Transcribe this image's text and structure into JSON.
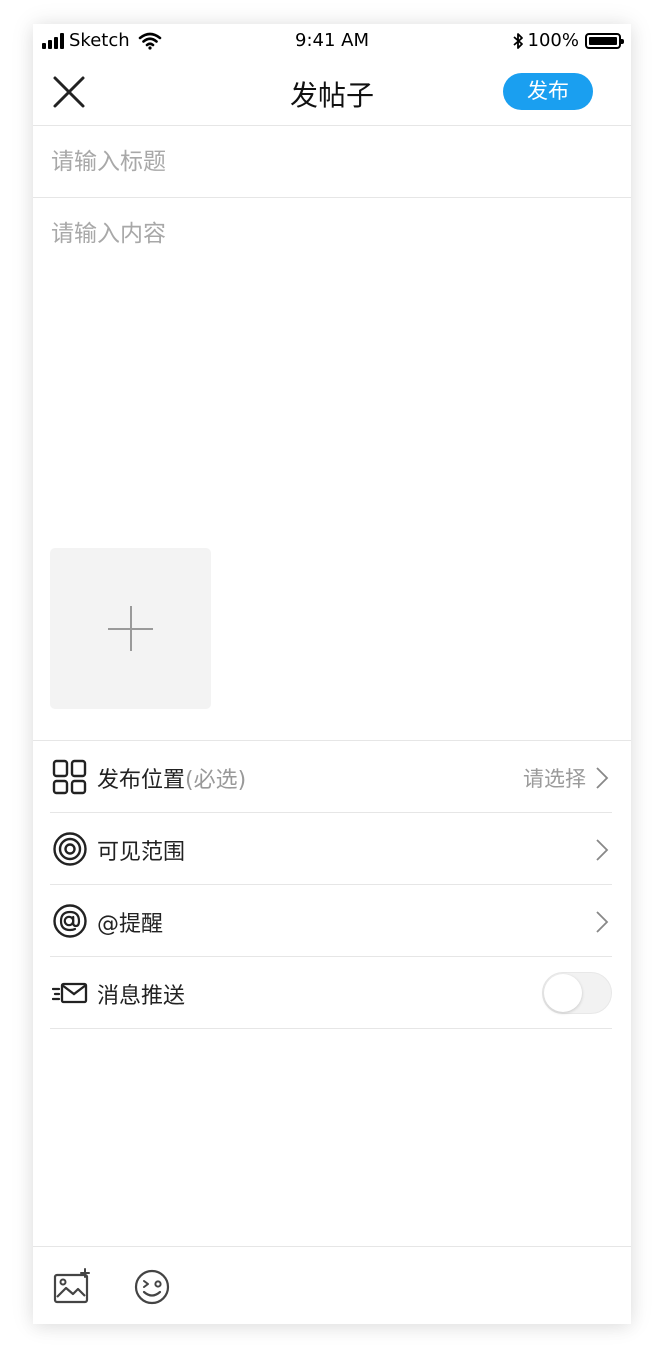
{
  "status_bar": {
    "carrier": "Sketch",
    "time": "9:41 AM",
    "battery": "100%"
  },
  "nav": {
    "title": "发帖子",
    "publish_label": "发布"
  },
  "form": {
    "title_placeholder": "请输入标题",
    "content_placeholder": "请输入内容"
  },
  "options": {
    "location": {
      "label": "发布位置",
      "hint": "(必选)",
      "value": "请选择"
    },
    "visibility": {
      "label": "可见范围"
    },
    "mention": {
      "label": "@提醒"
    },
    "push": {
      "label": "消息推送",
      "enabled": false
    }
  },
  "colors": {
    "accent": "#1a9ff0",
    "divider": "#e6e6e6",
    "placeholder": "#a8a8a8"
  },
  "icons": {
    "close": "close-icon",
    "add": "plus-icon",
    "location": "grid-icon",
    "visibility": "target-icon",
    "mention": "at-icon",
    "push": "mail-send-icon",
    "chevron": "chevron-right-icon",
    "image": "image-icon",
    "emoji": "emoji-icon"
  }
}
